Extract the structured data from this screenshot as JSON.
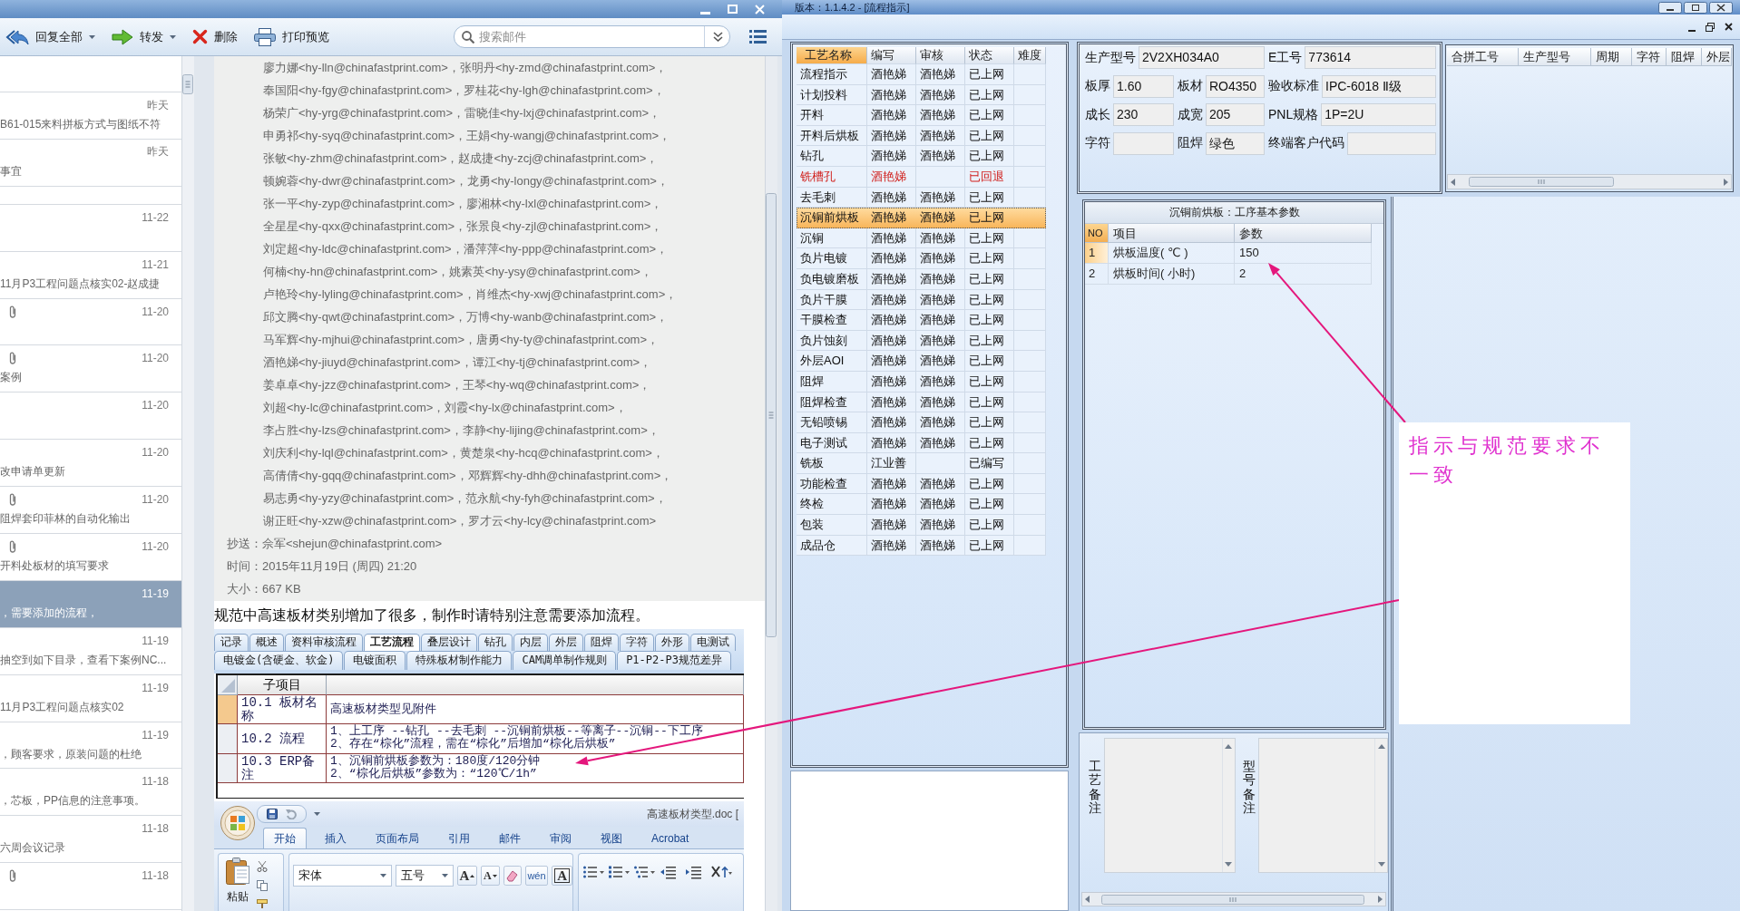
{
  "mail_window": {
    "toolbar": {
      "buttons": [
        {
          "kind": "reply_all",
          "label": "回复全部",
          "dropdown": true
        },
        {
          "kind": "forward",
          "label": "转发",
          "dropdown": true
        },
        {
          "kind": "delete",
          "label": "删除",
          "dropdown": false
        },
        {
          "kind": "print",
          "label": "打印预览",
          "dropdown": false
        }
      ],
      "search": {
        "placeholder": "搜索邮件"
      }
    },
    "mail_list": [
      {
        "kind": "gap"
      },
      {
        "kind": "message",
        "date": "昨天",
        "subject": "B61-015来料拼板方式与图纸不符",
        "attachment": false,
        "selected": false
      },
      {
        "kind": "message",
        "date": "昨天",
        "subject": "事宜",
        "attachment": false,
        "selected": false
      },
      {
        "kind": "gap"
      },
      {
        "kind": "message",
        "date": "11-22",
        "attachment": false,
        "selected": false
      },
      {
        "kind": "message",
        "date": "11-21",
        "subject": "11月P3工程问题点核实02-赵成捷",
        "attachment": false,
        "selected": false
      },
      {
        "kind": "message",
        "date": "11-20",
        "attachment": true,
        "selected": false
      },
      {
        "kind": "message",
        "date": "11-20",
        "subject": "案例",
        "attachment": true,
        "selected": false
      },
      {
        "kind": "message",
        "date": "11-20",
        "attachment": false,
        "selected": false
      },
      {
        "kind": "message",
        "date": "11-20",
        "subject": "改申请单更新",
        "attachment": false,
        "selected": false
      },
      {
        "kind": "message",
        "date": "11-20",
        "subject": "阻焊套印菲林的自动化输出",
        "attachment": true,
        "selected": false
      },
      {
        "kind": "message",
        "date": "11-20",
        "subject": "开料处板材的填写要求",
        "attachment": true,
        "selected": false
      },
      {
        "kind": "message",
        "date": "11-19",
        "subject": "，需要添加的流程，",
        "attachment": false,
        "selected": true
      },
      {
        "kind": "message",
        "date": "11-19",
        "subject": "抽空到如下目录，查看下案例NC...",
        "attachment": false,
        "selected": false
      },
      {
        "kind": "message",
        "date": "11-19",
        "subject": "11月P3工程问题点核实02",
        "attachment": false,
        "selected": false
      },
      {
        "kind": "message",
        "date": "11-19",
        "subject": "，顾客要求，原装问题的杜绝",
        "attachment": false,
        "selected": false
      },
      {
        "kind": "message",
        "date": "11-18",
        "subject": "，芯板，PP信息的注意事项。",
        "attachment": false,
        "selected": false
      },
      {
        "kind": "message",
        "date": "11-18",
        "subject": "六周会议记录",
        "attachment": false,
        "selected": false
      },
      {
        "kind": "message",
        "date": "11-18",
        "attachment": true,
        "selected": false
      }
    ],
    "message": {
      "recipients": [
        "廖力娜<hy-lln@chinafastprint.com>，张明丹<hy-zmd@chinafastprint.com>，",
        "奉国阳<hy-fgy@chinafastprint.com>，罗桂花<hy-lgh@chinafastprint.com>，",
        "杨荣广<hy-yrg@chinafastprint.com>，雷晓佳<hy-lxj@chinafastprint.com>，",
        "申勇祁<hy-syq@chinafastprint.com>，王娟<hy-wangj@chinafastprint.com>，",
        "张敏<hy-zhm@chinafastprint.com>，赵成捷<hy-zcj@chinafastprint.com>，",
        "顿婉蓉<hy-dwr@chinafastprint.com>，龙勇<hy-longy@chinafastprint.com>，",
        "张一平<hy-zyp@chinafastprint.com>，廖湘林<hy-lxl@chinafastprint.com>，",
        "全星星<hy-qxx@chinafastprint.com>，张景良<hy-zjl@chinafastprint.com>，",
        "刘定超<hy-ldc@chinafastprint.com>，潘萍萍<hy-ppp@chinafastprint.com>，",
        "何楠<hy-hn@chinafastprint.com>，姚素英<hy-ysy@chinafastprint.com>，",
        "卢艳玲<hy-lyling@chinafastprint.com>，肖维杰<hy-xwj@chinafastprint.com>，",
        "邱文腾<hy-qwt@chinafastprint.com>，万博<hy-wanb@chinafastprint.com>，",
        "马军辉<hy-mjhui@chinafastprint.com>，唐勇<hy-ty@chinafastprint.com>，",
        "酒艳娣<hy-jiuyd@chinafastprint.com>，谭江<hy-tj@chinafastprint.com>，",
        "姜卓卓<hy-jzz@chinafastprint.com>，王琴<hy-wq@chinafastprint.com>，",
        "刘超<hy-lc@chinafastprint.com>，刘霞<hy-lx@chinafastprint.com>，",
        "李占胜<hy-lzs@chinafastprint.com>，李静<hy-lijing@chinafastprint.com>，",
        "刘庆利<hy-lql@chinafastprint.com>，黄楚泉<hy-hcq@chinafastprint.com>，",
        "高倩倩<hy-gqq@chinafastprint.com>，邓辉辉<hy-dhh@chinafastprint.com>，",
        "易志勇<hy-yzy@chinafastprint.com>，范永航<hy-fyh@chinafastprint.com>，",
        "谢正旺<hy-xzw@chinafastprint.com>，罗才云<hy-lcy@chinafastprint.com>"
      ],
      "details": [
        "抄送：佘军<shejun@chinafastprint.com>",
        "时间：2015年11月19日 (周四) 21:20",
        "大小：667 KB"
      ],
      "body": "规范中高速板材类别增加了很多，制作时请特别注意需要添加流程。",
      "sheet": {
        "tab_rows": [
          [
            {
              "label": "记录",
              "selected": false
            },
            {
              "label": "概述",
              "selected": false
            },
            {
              "label": "资料审核流程",
              "selected": false
            },
            {
              "label": "工艺流程",
              "selected": true
            },
            {
              "label": "叠层设计",
              "selected": false
            },
            {
              "label": "钻孔",
              "selected": false
            },
            {
              "label": "内层",
              "selected": false
            },
            {
              "label": "外层",
              "selected": false
            },
            {
              "label": "阻焊",
              "selected": false
            },
            {
              "label": "字符",
              "selected": false
            },
            {
              "label": "外形",
              "selected": false
            },
            {
              "label": "电测试",
              "selected": false
            }
          ],
          [
            {
              "label": "电镀金(含硬金、软金)",
              "selected": false
            },
            {
              "label": "电镀面积",
              "selected": false
            },
            {
              "label": "特殊板材制作能力",
              "selected": false
            },
            {
              "label": "CAM调单制作规则",
              "selected": false
            },
            {
              "label": "P1-P2-P3规范差异",
              "selected": false
            }
          ]
        ],
        "table": {
          "header": "子项目",
          "rows": [
            {
              "item": "10.1 板材名称",
              "lines": [
                "高速板材类型见附件"
              ],
              "selected": true
            },
            {
              "item": "10.2 流程",
              "lines": [
                "1、上工序 --钻孔 --去毛刺 --沉铜前烘板--等离子--沉铜--下工序",
                "2、存在“棕化”流程，需在“棕化”后增加“棕化后烘板”"
              ],
              "selected": false
            },
            {
              "item": "10.3 ERP备注",
              "lines": [
                "1、沉铜前烘板参数为：180度/120分钟",
                "2、“棕化后烘板”参数为：“120℃/1h”"
              ],
              "selected": false
            }
          ]
        }
      },
      "word": {
        "title": "高速板材类型.doc [",
        "tabs": [
          {
            "label": "开始",
            "selected": true
          },
          {
            "label": "插入",
            "selected": false
          },
          {
            "label": "页面布局",
            "selected": false
          },
          {
            "label": "引用",
            "selected": false
          },
          {
            "label": "邮件",
            "selected": false
          },
          {
            "label": "审阅",
            "selected": false
          },
          {
            "label": "视图",
            "selected": false
          },
          {
            "label": "Acrobat",
            "selected": false
          }
        ],
        "paste": "粘贴",
        "font": "宋体",
        "size": "五号",
        "font_buttons": [
          {
            "kind": "grow",
            "label": "A"
          },
          {
            "kind": "shrink",
            "label": "A"
          },
          {
            "kind": "clear"
          },
          {
            "kind": "phonetic",
            "label": "wén"
          },
          {
            "kind": "border",
            "label": "A"
          }
        ]
      }
    }
  },
  "erp_window": {
    "title": "版本：1.1.4.2 - [流程指示]",
    "process_table": {
      "columns": [
        {
          "label": "工艺名称",
          "selected": true
        },
        {
          "label": "编写",
          "selected": false
        },
        {
          "label": "审核",
          "selected": false
        },
        {
          "label": "状态",
          "selected": false
        },
        {
          "label": "难度",
          "selected": false
        }
      ],
      "rows": [
        {
          "kind": "normal",
          "name": "流程指示",
          "writer": "酒艳娣",
          "reviewer": "酒艳娣",
          "status": "已上网",
          "selected": false
        },
        {
          "kind": "normal",
          "name": "计划投料",
          "writer": "酒艳娣",
          "reviewer": "酒艳娣",
          "status": "已上网",
          "selected": false
        },
        {
          "kind": "normal",
          "name": "开料",
          "writer": "酒艳娣",
          "reviewer": "酒艳娣",
          "status": "已上网",
          "selected": false
        },
        {
          "kind": "normal",
          "name": "开料后烘板",
          "writer": "酒艳娣",
          "reviewer": "酒艳娣",
          "status": "已上网",
          "selected": false
        },
        {
          "kind": "normal",
          "name": "钻孔",
          "writer": "酒艳娣",
          "reviewer": "酒艳娣",
          "status": "已上网",
          "selected": false
        },
        {
          "kind": "returned",
          "name": "铣槽孔",
          "writer": "酒艳娣",
          "status": "已回退",
          "selected": false
        },
        {
          "kind": "normal",
          "name": "去毛刺",
          "writer": "酒艳娣",
          "reviewer": "酒艳娣",
          "status": "已上网",
          "selected": false
        },
        {
          "kind": "normal",
          "name": "沉铜前烘板",
          "writer": "酒艳娣",
          "reviewer": "酒艳娣",
          "status": "已上网",
          "selected": true
        },
        {
          "kind": "normal",
          "name": "沉铜",
          "writer": "酒艳娣",
          "reviewer": "酒艳娣",
          "status": "已上网",
          "selected": false
        },
        {
          "kind": "normal",
          "name": "负片电镀",
          "writer": "酒艳娣",
          "reviewer": "酒艳娣",
          "status": "已上网",
          "selected": false
        },
        {
          "kind": "normal",
          "name": "负电镀磨板",
          "writer": "酒艳娣",
          "reviewer": "酒艳娣",
          "status": "已上网",
          "selected": false
        },
        {
          "kind": "normal",
          "name": "负片干膜",
          "writer": "酒艳娣",
          "reviewer": "酒艳娣",
          "status": "已上网",
          "selected": false
        },
        {
          "kind": "normal",
          "name": "干膜检查",
          "writer": "酒艳娣",
          "reviewer": "酒艳娣",
          "status": "已上网",
          "selected": false
        },
        {
          "kind": "normal",
          "name": "负片蚀刻",
          "writer": "酒艳娣",
          "reviewer": "酒艳娣",
          "status": "已上网",
          "selected": false
        },
        {
          "kind": "normal",
          "name": "外层AOI",
          "writer": "酒艳娣",
          "reviewer": "酒艳娣",
          "status": "已上网",
          "selected": false
        },
        {
          "kind": "normal",
          "name": "阻焊",
          "writer": "酒艳娣",
          "reviewer": "酒艳娣",
          "status": "已上网",
          "selected": false
        },
        {
          "kind": "normal",
          "name": "阻焊检查",
          "writer": "酒艳娣",
          "reviewer": "酒艳娣",
          "status": "已上网",
          "selected": false
        },
        {
          "kind": "normal",
          "name": "无铅喷锡",
          "writer": "酒艳娣",
          "reviewer": "酒艳娣",
          "status": "已上网",
          "selected": false
        },
        {
          "kind": "normal",
          "name": "电子测试",
          "writer": "酒艳娣",
          "reviewer": "酒艳娣",
          "status": "已上网",
          "selected": false
        },
        {
          "kind": "normal",
          "name": "铣板",
          "writer": "江业善",
          "status": "已编写",
          "selected": false
        },
        {
          "kind": "normal",
          "name": "功能检查",
          "writer": "酒艳娣",
          "reviewer": "酒艳娣",
          "status": "已上网",
          "selected": false
        },
        {
          "kind": "normal",
          "name": "终检",
          "writer": "酒艳娣",
          "reviewer": "酒艳娣",
          "status": "已上网",
          "selected": false
        },
        {
          "kind": "normal",
          "name": "包装",
          "writer": "酒艳娣",
          "reviewer": "酒艳娣",
          "status": "已上网",
          "selected": false
        },
        {
          "kind": "normal",
          "name": "成品仓",
          "writer": "酒艳娣",
          "reviewer": "酒艳娣",
          "status": "已上网",
          "selected": false
        }
      ]
    },
    "product_info": {
      "fields": [
        {
          "kind": "wide",
          "label": "生产型号",
          "value": "2V2XH034A0"
        },
        {
          "kind": "normal",
          "label": "E工号",
          "value": "773614"
        },
        {
          "kind": "normal",
          "label": "板厚",
          "value": "1.60"
        },
        {
          "kind": "normal",
          "label": "板材",
          "value": "RO4350"
        },
        {
          "kind": "normal",
          "label": "验收标准",
          "value": "IPC-6018 Ⅱ级"
        },
        {
          "kind": "normal",
          "label": "成长",
          "value": "230"
        },
        {
          "kind": "normal",
          "label": "成宽",
          "value": "205"
        },
        {
          "kind": "normal",
          "label": "PNL规格",
          "value": "1P=2U"
        },
        {
          "kind": "normal",
          "label": "字符"
        },
        {
          "kind": "normal",
          "label": "阻焊",
          "value": "绿色"
        },
        {
          "kind": "normal",
          "label": "终端客户代码"
        }
      ]
    },
    "merge_table": {
      "columns": [
        "合拼工号",
        "生产型号",
        "周期",
        "字符",
        "阻焊",
        "外层"
      ]
    },
    "parameters": {
      "title": "沉铜前烘板：工序基本参数",
      "columns": [
        {
          "label": "NO",
          "selected": true
        },
        {
          "label": "项目",
          "selected": false
        },
        {
          "label": "参数",
          "selected": false
        }
      ],
      "rows": [
        {
          "no": "1",
          "item": "烘板温度( ℃ )",
          "value": "150",
          "selected": true
        },
        {
          "no": "2",
          "item": "烘板时间( 小时)",
          "value": "2",
          "selected": false
        }
      ]
    },
    "remarks": [
      {
        "label": "工艺备注"
      },
      {
        "label": "型号备注"
      }
    ]
  },
  "annotation": {
    "text": "指示与规范要求不一致"
  }
}
